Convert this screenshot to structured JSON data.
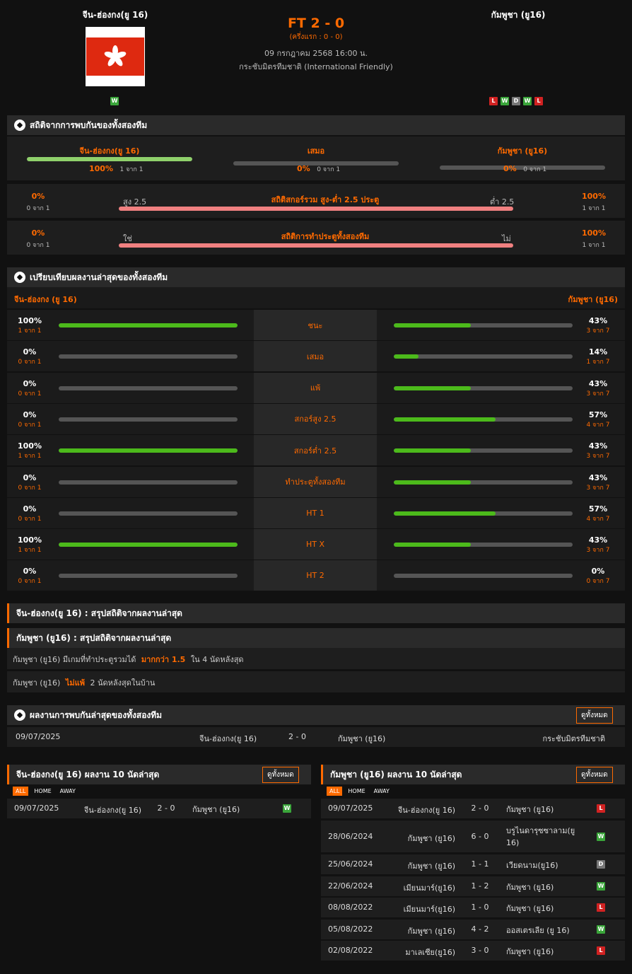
{
  "header": {
    "home_team": "จีน-ฮ่องกง(ยู 16)",
    "away_team": "กัมพูชา (ยู16)",
    "score": "FT 2 - 0",
    "halftime": "(ครึ่งแรก : 0 - 0)",
    "datetime": "09 กรกฎาคม 2568 16:00 น.",
    "competition": "กระชับมิตรทีมชาติ (International Friendly)",
    "home_form": [
      "W"
    ],
    "away_form": [
      "L",
      "W",
      "D",
      "W",
      "L"
    ]
  },
  "h2h": {
    "title": "สถิติจากการพบกันของทั้งสองทีม",
    "home": {
      "label": "จีน-ฮ่องกง(ยู 16)",
      "pct": "100%",
      "sub": "1 จาก 1",
      "fill": 1.0
    },
    "draw": {
      "label": "เสมอ",
      "pct": "0%",
      "sub": "0 จาก 1",
      "fill": 0
    },
    "away": {
      "label": "กัมพูชา (ยู16)",
      "pct": "0%",
      "sub": "0 จาก 1",
      "fill": 0
    },
    "ou": {
      "title": "สถิติสกอร์รวม สูง-ต่ำ 2.5 ประตู",
      "left_label": "สูง 2.5",
      "right_label": "ต่ำ 2.5",
      "left_pct": "0%",
      "left_sub": "0 จาก 1",
      "right_pct": "100%",
      "right_sub": "1 จาก 1"
    },
    "btts": {
      "title": "สถิติการทำประตูทั้งสองทีม",
      "left_label": "ใช่",
      "right_label": "ไม่",
      "left_pct": "0%",
      "left_sub": "0 จาก 1",
      "right_pct": "100%",
      "right_sub": "1 จาก 1"
    }
  },
  "compare": {
    "title": "เปรียบเทียบผลงานล่าสุดของทั้งสองทีม",
    "home_label": "จีน-ฮ่องกง (ยู 16)",
    "away_label": "กัมพูชา (ยู16)",
    "rows": [
      {
        "label": "ชนะ",
        "l_pct": "100%",
        "l_sub": "1 จาก 1",
        "l_fill": 1.0,
        "r_pct": "43%",
        "r_sub": "3 จาก 7",
        "r_fill": 0.43
      },
      {
        "label": "เสมอ",
        "l_pct": "0%",
        "l_sub": "0 จาก 1",
        "l_fill": 0,
        "r_pct": "14%",
        "r_sub": "1 จาก 7",
        "r_fill": 0.14
      },
      {
        "label": "แพ้",
        "l_pct": "0%",
        "l_sub": "0 จาก 1",
        "l_fill": 0,
        "r_pct": "43%",
        "r_sub": "3 จาก 7",
        "r_fill": 0.43
      },
      {
        "label": "สกอร์สูง 2.5",
        "l_pct": "0%",
        "l_sub": "0 จาก 1",
        "l_fill": 0,
        "r_pct": "57%",
        "r_sub": "4 จาก 7",
        "r_fill": 0.57
      },
      {
        "label": "สกอร์ต่ำ 2.5",
        "l_pct": "100%",
        "l_sub": "1 จาก 1",
        "l_fill": 1.0,
        "r_pct": "43%",
        "r_sub": "3 จาก 7",
        "r_fill": 0.43
      },
      {
        "label": "ทำประตูทั้งสองทีม",
        "l_pct": "0%",
        "l_sub": "0 จาก 1",
        "l_fill": 0,
        "r_pct": "43%",
        "r_sub": "3 จาก 7",
        "r_fill": 0.43
      },
      {
        "label": "HT 1",
        "l_pct": "0%",
        "l_sub": "0 จาก 1",
        "l_fill": 0,
        "r_pct": "57%",
        "r_sub": "4 จาก 7",
        "r_fill": 0.57
      },
      {
        "label": "HT X",
        "l_pct": "100%",
        "l_sub": "1 จาก 1",
        "l_fill": 1.0,
        "r_pct": "43%",
        "r_sub": "3 จาก 7",
        "r_fill": 0.43
      },
      {
        "label": "HT 2",
        "l_pct": "0%",
        "l_sub": "0 จาก 1",
        "l_fill": 0,
        "r_pct": "0%",
        "r_sub": "0 จาก 7",
        "r_fill": 0
      }
    ]
  },
  "summary": {
    "home_title": "จีน-ฮ่องกง(ยู 16) : สรุปสถิติจากผลงานล่าสุด",
    "away_title": "กัมพูชา (ยู16) : สรุปสถิติจากผลงานล่าสุด",
    "line1": {
      "a": "กัมพูชา (ยู16)  มีเกมที่ทำประตูรวมได้",
      "b": "มากกว่า  1.5",
      "c": "ใน 4 นัดหลังสุด"
    },
    "line2": {
      "a": "กัมพูชา (ยู16)",
      "b": "ไม่แพ้",
      "c": "2  นัดหลังสุดในบ้าน"
    }
  },
  "h2h_results": {
    "title": "ผลงานการพบกันล่าสุดของทั้งสองทีม",
    "view_all": "ดูทั้งหมด",
    "row": {
      "date": "09/07/2025",
      "home": "จีน-ฮ่องกง(ยู 16)",
      "score": "2 - 0",
      "away": "กัมพูชา (ยู16)",
      "comp": "กระชับมิตรทีมชาติ"
    }
  },
  "last10_home": {
    "title": "จีน-ฮ่องกง(ยู 16) ผลงาน 10 นัดล่าสุด",
    "view_all": "ดูทั้งหมด",
    "tabs": [
      "ALL",
      "HOME",
      "AWAY"
    ],
    "rows": [
      {
        "date": "09/07/2025",
        "home": "จีน-ฮ่องกง(ยู 16)",
        "score": "2 - 0",
        "away": "กัมพูชา (ยู16)",
        "result": "W"
      }
    ]
  },
  "last10_away": {
    "title": "กัมพูชา (ยู16) ผลงาน 10 นัดล่าสุด",
    "view_all": "ดูทั้งหมด",
    "tabs": [
      "ALL",
      "HOME",
      "AWAY"
    ],
    "rows": [
      {
        "date": "09/07/2025",
        "home": "จีน-ฮ่องกง(ยู 16)",
        "score": "2 - 0",
        "away": "กัมพูชา (ยู16)",
        "result": "L"
      },
      {
        "date": "28/06/2024",
        "home": "กัมพูชา (ยู16)",
        "score": "6 - 0",
        "away": "บรูไนดารุซซาลาม(ยู 16)",
        "result": "W"
      },
      {
        "date": "25/06/2024",
        "home": "กัมพูชา (ยู16)",
        "score": "1 - 1",
        "away": "เวียดนาม(ยู16)",
        "result": "D"
      },
      {
        "date": "22/06/2024",
        "home": "เมียนมาร์(ยู16)",
        "score": "1 - 2",
        "away": "กัมพูชา (ยู16)",
        "result": "W"
      },
      {
        "date": "08/08/2022",
        "home": "เมียนมาร์(ยู16)",
        "score": "1 - 0",
        "away": "กัมพูชา (ยู16)",
        "result": "L"
      },
      {
        "date": "05/08/2022",
        "home": "กัมพูชา (ยู16)",
        "score": "4 - 2",
        "away": "ออสเตรเลีย (ยู 16)",
        "result": "W"
      },
      {
        "date": "02/08/2022",
        "home": "มาเลเซีย(ยู16)",
        "score": "3 - 0",
        "away": "กัมพูชา (ยู16)",
        "result": "L"
      }
    ]
  }
}
